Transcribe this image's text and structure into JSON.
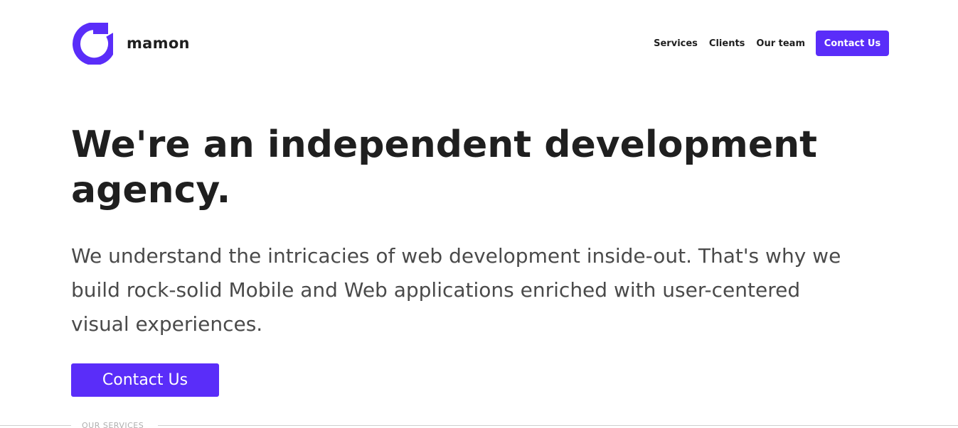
{
  "brand": {
    "name": "mamon",
    "logo_icon": "mamon-logo-icon",
    "accent_color": "#5a2df9"
  },
  "nav": {
    "items": [
      {
        "label": "Services"
      },
      {
        "label": "Clients"
      },
      {
        "label": "Our team"
      }
    ],
    "cta_label": "Contact Us"
  },
  "hero": {
    "title_line1": "We're an independent development",
    "title_line2": "agency.",
    "text_line1": "We understand the intricacies of web development inside-out. That's why we",
    "text_line2": "build rock-solid Mobile and Web applications enriched with user-centered",
    "text_line3": "visual experiences.",
    "cta_label": "Contact Us"
  },
  "section": {
    "label": "OUR SERVICES"
  }
}
